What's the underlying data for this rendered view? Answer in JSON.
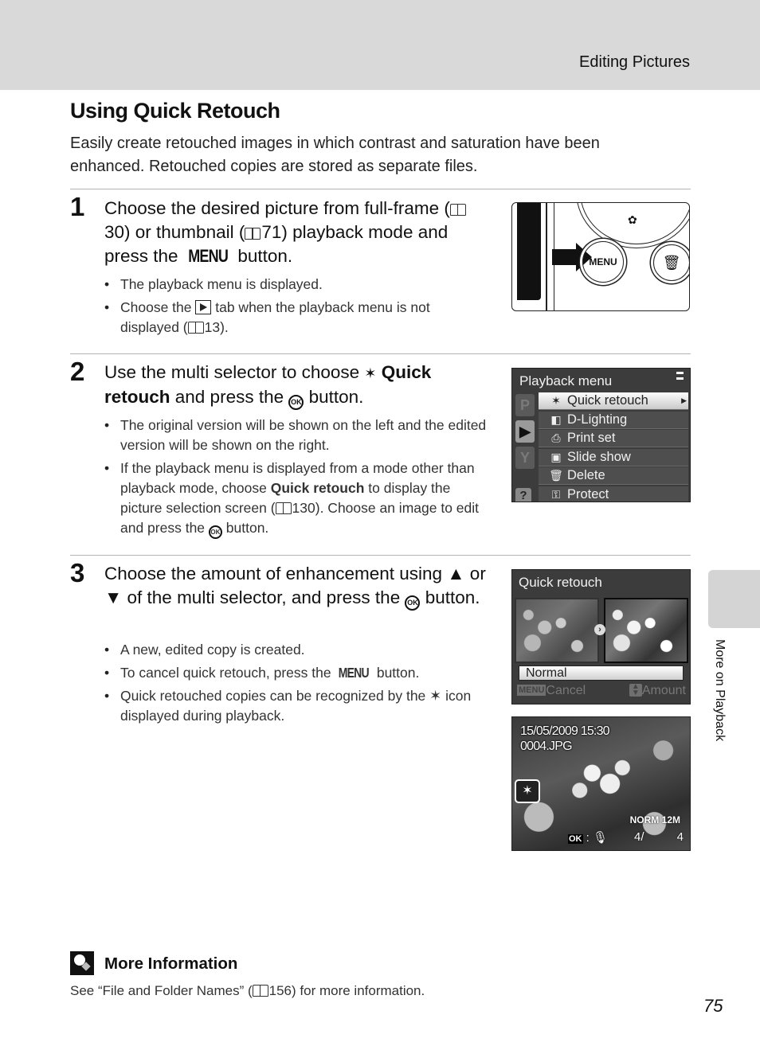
{
  "header": {
    "section": "Editing Pictures"
  },
  "title": "Using Quick Retouch",
  "intro": "Easily create retouched images in which contrast and saturation have been enhanced. Retouched copies are stored as separate files.",
  "steps": [
    {
      "number": "1",
      "heading_parts": {
        "a": "Choose the desired picture from full-frame (",
        "ref1": "30",
        "b": ") or thumbnail (",
        "ref2": "71",
        "c": ") playback mode and press the ",
        "menu": "MENU",
        "d": " button."
      },
      "bullets": {
        "b1": "The playback menu is displayed.",
        "b2_a": "Choose the ",
        "b2_b": " tab when the playback menu is not displayed (",
        "b2_ref": "13",
        "b2_c": ")."
      }
    },
    {
      "number": "2",
      "heading_parts": {
        "a": "Use the multi selector to choose ",
        "icon": "✶",
        "bold1": "Quick retouch",
        "b": " and press the ",
        "ok": "OK",
        "c": " button."
      },
      "bullets": {
        "b1": "The original version will be shown on the left and the edited version will be shown on the right.",
        "b2_a": "If the playback menu is displayed from a mode other than playback mode, choose ",
        "b2_bold": "Quick retouch",
        "b2_b": " to display the picture selection screen (",
        "b2_ref": "130",
        "b2_c": "). Choose an image to edit and press the ",
        "b2_ok": "OK",
        "b2_d": " button."
      }
    },
    {
      "number": "3",
      "heading_parts": {
        "a": "Choose the amount of enhancement using ▲ or ▼ of the multi selector, and press the ",
        "ok": "OK",
        "b": " button."
      },
      "bullets": {
        "b1": "A new, edited copy is created.",
        "b2_a": "To cancel quick retouch, press the ",
        "b2_menu": "MENU",
        "b2_b": " button.",
        "b3_a": "Quick retouched copies can be recognized by the ",
        "b3_icon": "✶",
        "b3_b": " icon displayed during playback."
      }
    }
  ],
  "camera_illustration": {
    "menu_button": "MENU",
    "trash_icon": "🗑",
    "macro_icon": "✿"
  },
  "playback_menu": {
    "title": "Playback menu",
    "tabs": [
      "P",
      "▶",
      "Y",
      "?"
    ],
    "items": [
      {
        "icon": "✶",
        "label": "Quick retouch",
        "selected": true
      },
      {
        "icon": "◧",
        "label": "D-Lighting"
      },
      {
        "icon": "⎙",
        "label": "Print set"
      },
      {
        "icon": "▣",
        "label": "Slide show"
      },
      {
        "icon": "🗑",
        "label": "Delete"
      },
      {
        "icon": "⚿",
        "label": "Protect"
      }
    ]
  },
  "quick_retouch_screen": {
    "title": "Quick retouch",
    "value": "Normal",
    "cancel_key": "MENU",
    "cancel_label": "Cancel",
    "amount_label": "Amount"
  },
  "playback_screen": {
    "datetime": "15/05/2009 15:30",
    "filename": "0004.JPG",
    "quality": "NORM",
    "size": "12M",
    "ok_label": "OK",
    "frame": "4/",
    "total": "4"
  },
  "side_tab": {
    "label": "More on Playback"
  },
  "more_info": {
    "title": "More Information",
    "text_a": "See “File and Folder Names” (",
    "ref": "156",
    "text_b": ") for more information."
  },
  "page_number": "75"
}
